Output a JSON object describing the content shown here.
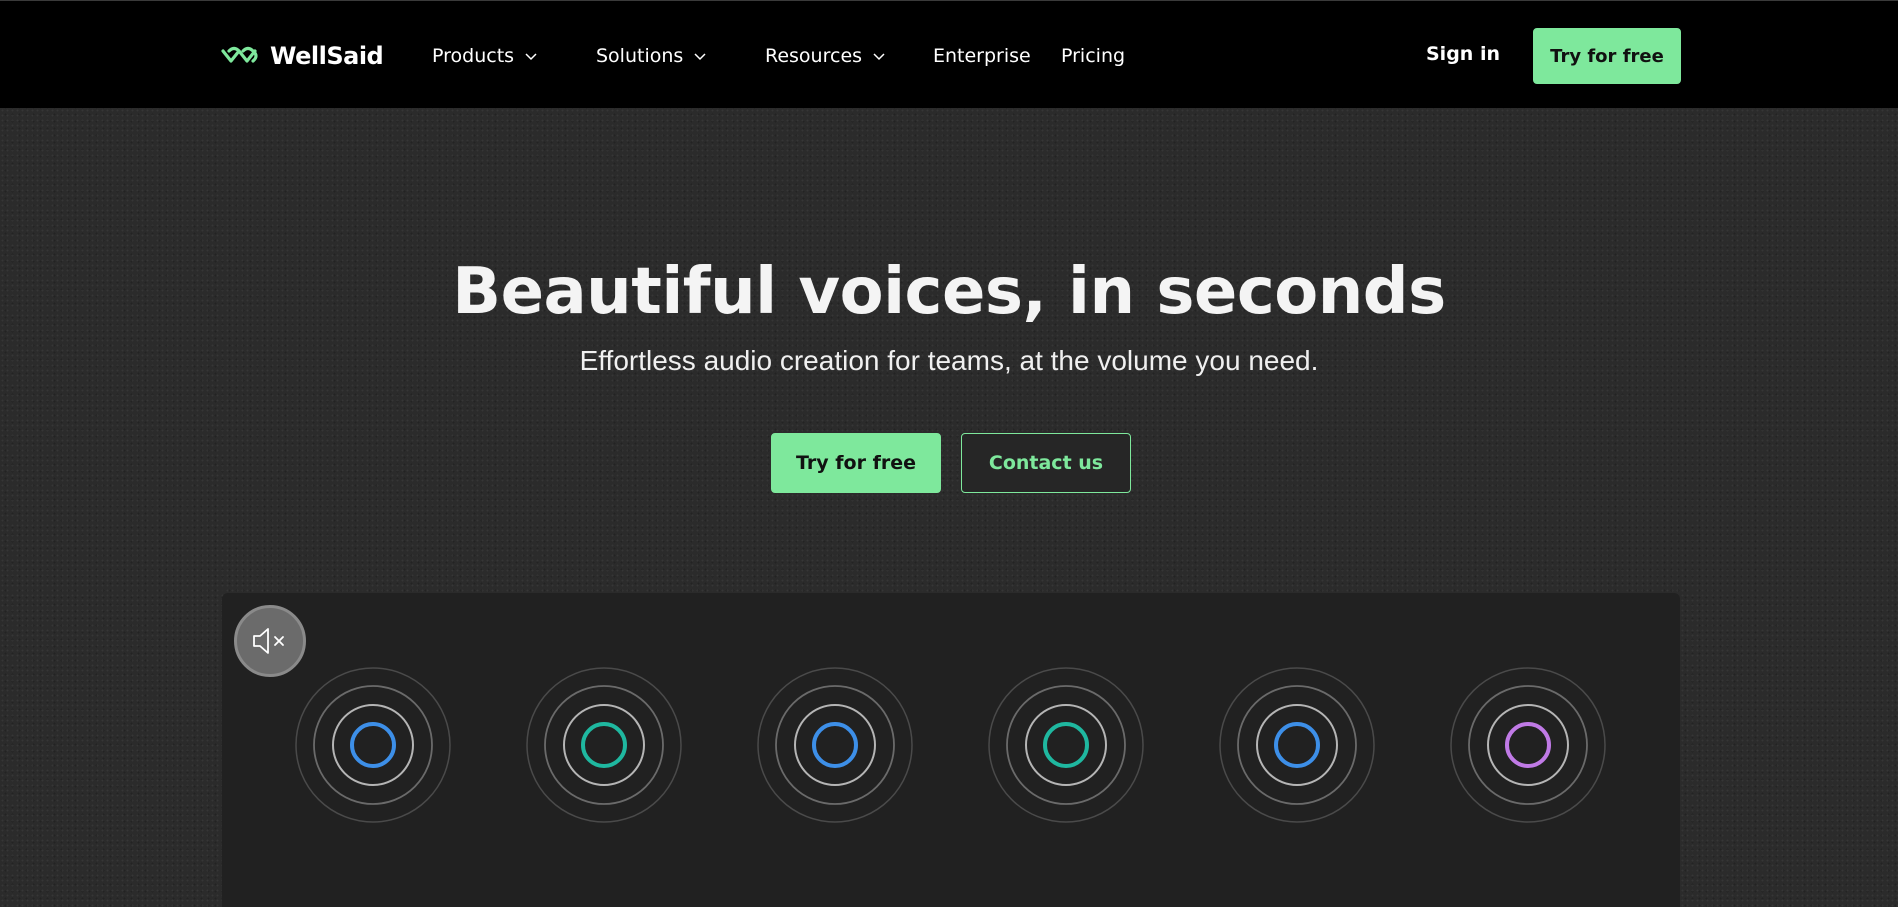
{
  "brand": {
    "name": "WellSaid",
    "logo_color": "#7ee89c"
  },
  "nav": {
    "items": [
      {
        "label": "Products",
        "has_dropdown": true
      },
      {
        "label": "Solutions",
        "has_dropdown": true
      },
      {
        "label": "Resources",
        "has_dropdown": true
      },
      {
        "label": "Enterprise",
        "has_dropdown": false
      },
      {
        "label": "Pricing",
        "has_dropdown": false
      }
    ],
    "sign_in_label": "Sign in",
    "cta_label": "Try for free"
  },
  "hero": {
    "title": "Beautiful voices, in seconds",
    "subtitle": "Effortless audio creation for teams, at the volume you need.",
    "primary_button": "Try for free",
    "secondary_button": "Contact us"
  },
  "voice_panel": {
    "mute_icon": "speaker-muted-icon",
    "voices": [
      {
        "icon": "voice-ring-icon",
        "color": "#3d8fe8"
      },
      {
        "icon": "voice-ring-icon",
        "color": "#1fb8a0"
      },
      {
        "icon": "voice-ring-icon",
        "color": "#3d8fe8"
      },
      {
        "icon": "voice-ring-icon",
        "color": "#1fb8a0"
      },
      {
        "icon": "voice-ring-icon",
        "color": "#3d8fe8"
      },
      {
        "icon": "voice-ring-icon",
        "color": "#c07ae6"
      }
    ]
  },
  "colors": {
    "accent": "#7ee89c",
    "header_bg": "#000000",
    "page_bg": "#2b2b2b",
    "panel_bg": "#212121"
  }
}
